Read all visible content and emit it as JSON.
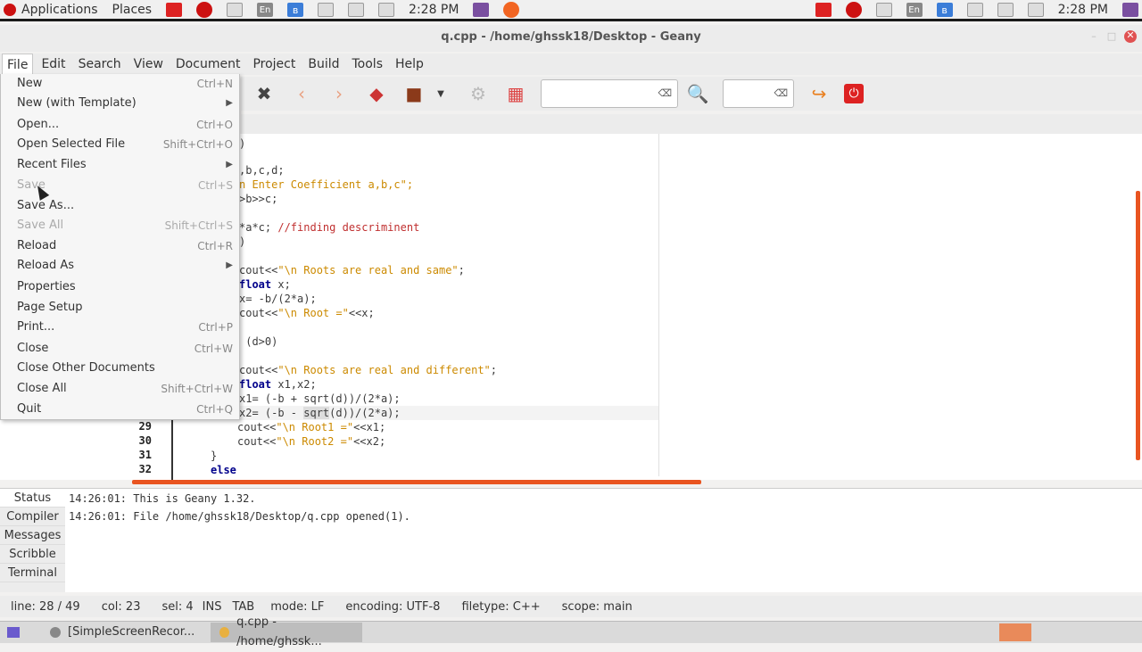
{
  "top_panel": {
    "applications": "Applications",
    "places": "Places",
    "keyboard_layout": "En",
    "bluetooth": "ʙ",
    "clock": "2:28 PM"
  },
  "window": {
    "title": "q.cpp - /home/ghssk18/Desktop - Geany"
  },
  "menu": [
    "File",
    "Edit",
    "Search",
    "View",
    "Document",
    "Project",
    "Build",
    "Tools",
    "Help"
  ],
  "file_menu": [
    {
      "label": "New",
      "shortcut": "Ctrl+N",
      "enabled": true
    },
    {
      "label": "New (with Template)",
      "submenu": true,
      "enabled": true
    },
    {
      "label": "Open...",
      "shortcut": "Ctrl+O",
      "enabled": true
    },
    {
      "label": "Open Selected File",
      "shortcut": "Shift+Ctrl+O",
      "enabled": true
    },
    {
      "label": "Recent Files",
      "submenu": true,
      "enabled": true
    },
    {
      "label": "Save",
      "shortcut": "Ctrl+S",
      "enabled": false
    },
    {
      "label": "Save As...",
      "shortcut": "",
      "enabled": true
    },
    {
      "label": "Save All",
      "shortcut": "Shift+Ctrl+S",
      "enabled": false
    },
    {
      "label": "Reload",
      "shortcut": "Ctrl+R",
      "enabled": true
    },
    {
      "label": "Reload As",
      "submenu": true,
      "enabled": true
    },
    {
      "label": "Properties",
      "shortcut": "",
      "enabled": true
    },
    {
      "label": "Page Setup",
      "shortcut": "",
      "enabled": true
    },
    {
      "label": "Print...",
      "shortcut": "Ctrl+P",
      "enabled": true
    },
    {
      "label": "Close",
      "shortcut": "Ctrl+W",
      "enabled": true
    },
    {
      "label": "Close Other Documents",
      "shortcut": "",
      "enabled": true
    },
    {
      "label": "Close All",
      "shortcut": "Shift+Ctrl+W",
      "enabled": true
    },
    {
      "label": "Quit",
      "shortcut": "Ctrl+Q",
      "enabled": true
    }
  ],
  "editor": {
    "line_numbers": [
      "29",
      "30",
      "31",
      "32"
    ],
    "code": {
      "l1": ")",
      "l2": ",b,c,d;",
      "l3a": "n Enter Coefficient a,b,c\";",
      "l4": ">b>>c;",
      "l5a": "*a*c; ",
      "l5b": "//finding descriminent",
      "l6": ")",
      "l7a": "cout<<",
      "l7b": "\"\\n Roots are real and same\"",
      "l7c": ";",
      "l8a": "float",
      "l8b": " x;",
      "l9": "x= -b/(2*a);",
      "l10a": "cout<<",
      "l10b": "\"\\n Root =\"",
      "l10c": "<<x;",
      "l11": " (d>0)",
      "l12a": "cout<<",
      "l12b": "\"\\n Roots are real and different\"",
      "l12c": ";",
      "l13a": "float",
      "l13b": " x1,x2;",
      "l14": "x1= (-b + sqrt(d))/(2*a);",
      "l15a": "x2= (-b - ",
      "l15b": "sqrt",
      "l15c": "(d))/(2*a);",
      "l16a": "cout<<",
      "l16b": "\"\\n Root1 =\"",
      "l16c": "<<x1;",
      "l17a": "cout<<",
      "l17b": "\"\\n Root2 =\"",
      "l17c": "<<x2;",
      "l18": "}",
      "l19": "else"
    }
  },
  "messages": {
    "tabs": [
      "Status",
      "Compiler",
      "Messages",
      "Scribble",
      "Terminal"
    ],
    "lines": [
      "14:26:01: This is Geany 1.32.",
      "14:26:01: File /home/ghssk18/Desktop/q.cpp opened(1)."
    ]
  },
  "status_bar": {
    "line": "line: 28 / 49",
    "col": "col: 23",
    "sel": "sel: 4",
    "ins": "INS",
    "tab": "TAB",
    "mode": "mode: LF",
    "encoding": "encoding: UTF-8",
    "filetype": "filetype: C++",
    "scope": "scope: main"
  },
  "taskbar": {
    "task1": "[SimpleScreenRecor...",
    "task2": "q.cpp - /home/ghssk..."
  },
  "colors": {
    "accent": "#e95420",
    "keyword": "#00008b",
    "string": "#cc8a00",
    "comment": "#c03030"
  }
}
